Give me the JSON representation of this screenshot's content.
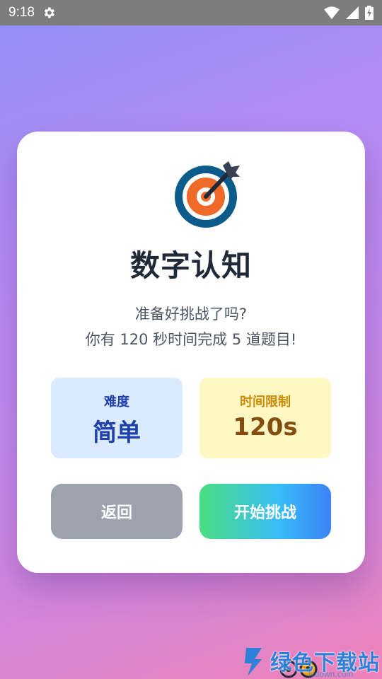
{
  "status_bar": {
    "time": "9:18",
    "icons": [
      "gear-icon",
      "wifi-icon",
      "signal-icon",
      "battery-charging-icon"
    ],
    "color": "#7d7d7d"
  },
  "card": {
    "icon": "target-icon",
    "title": "数字认知",
    "subtitle_line1": "准备好挑战了吗?",
    "subtitle_line2": "你有 120 秒时间完成 5 道题目!",
    "difficulty": {
      "label": "难度",
      "value": "简单",
      "bg": "#dbeafe",
      "color": "#1e40af"
    },
    "time_limit": {
      "label": "时间限制",
      "value": "120s",
      "bg": "#fef7c3",
      "color": "#854d0e"
    },
    "back_button": "返回",
    "start_button": "开始挑战"
  },
  "watermark": {
    "text": "绿色下载站",
    "url": "lvdown.com"
  }
}
